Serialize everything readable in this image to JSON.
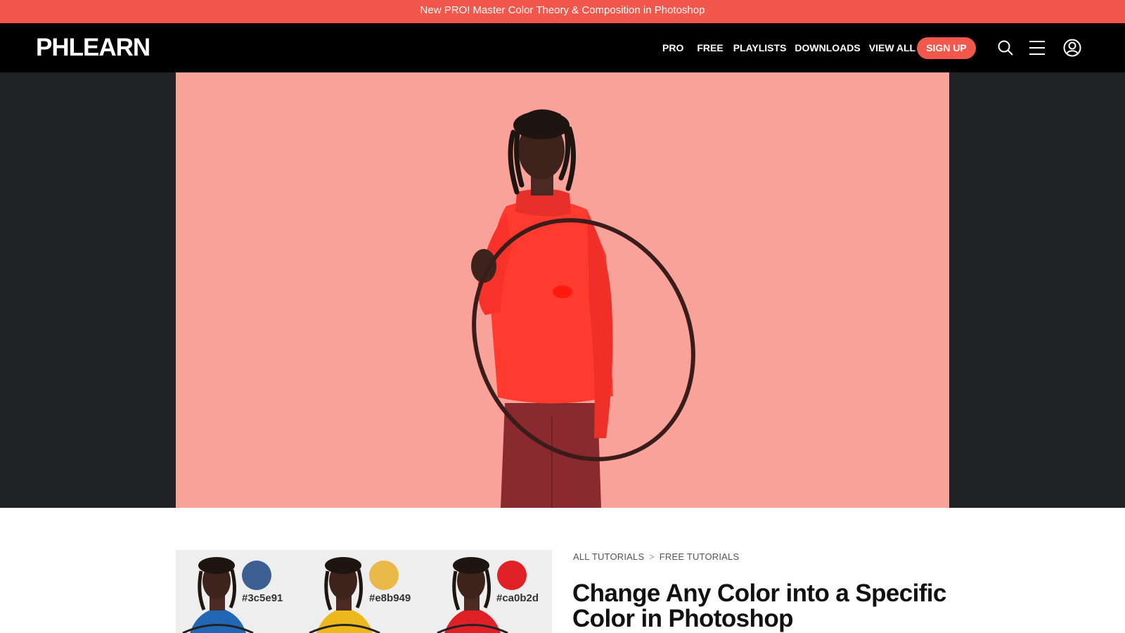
{
  "promo": {
    "text": "New PRO! Master Color Theory & Composition in Photoshop"
  },
  "nav": {
    "logo": "PHLEARN",
    "links": [
      "PRO",
      "FREE",
      "PLAYLISTS",
      "DOWNLOADS",
      "VIEW ALL"
    ],
    "signup": "SIGN UP",
    "icons": [
      "search-icon",
      "menu-icon",
      "account-icon"
    ]
  },
  "hero": {
    "background": "#f9a299",
    "sweater_color": "#ff3a2e"
  },
  "article": {
    "breadcrumb": {
      "first": "ALL TUTORIALS",
      "separator": ">",
      "second": "FREE TUTORIALS"
    },
    "title": "Change Any Color into a Specific Color in Photoshop",
    "swatches": [
      {
        "hex": "#3c5e91",
        "color": "#3c5e91"
      },
      {
        "hex": "#e8b949",
        "color": "#e8b949"
      },
      {
        "hex": "#ca0b2d",
        "color": "#e02027"
      }
    ]
  },
  "colors": {
    "accent": "#f2574b",
    "nav_bg": "#000000",
    "hero_frame": "#202225"
  }
}
